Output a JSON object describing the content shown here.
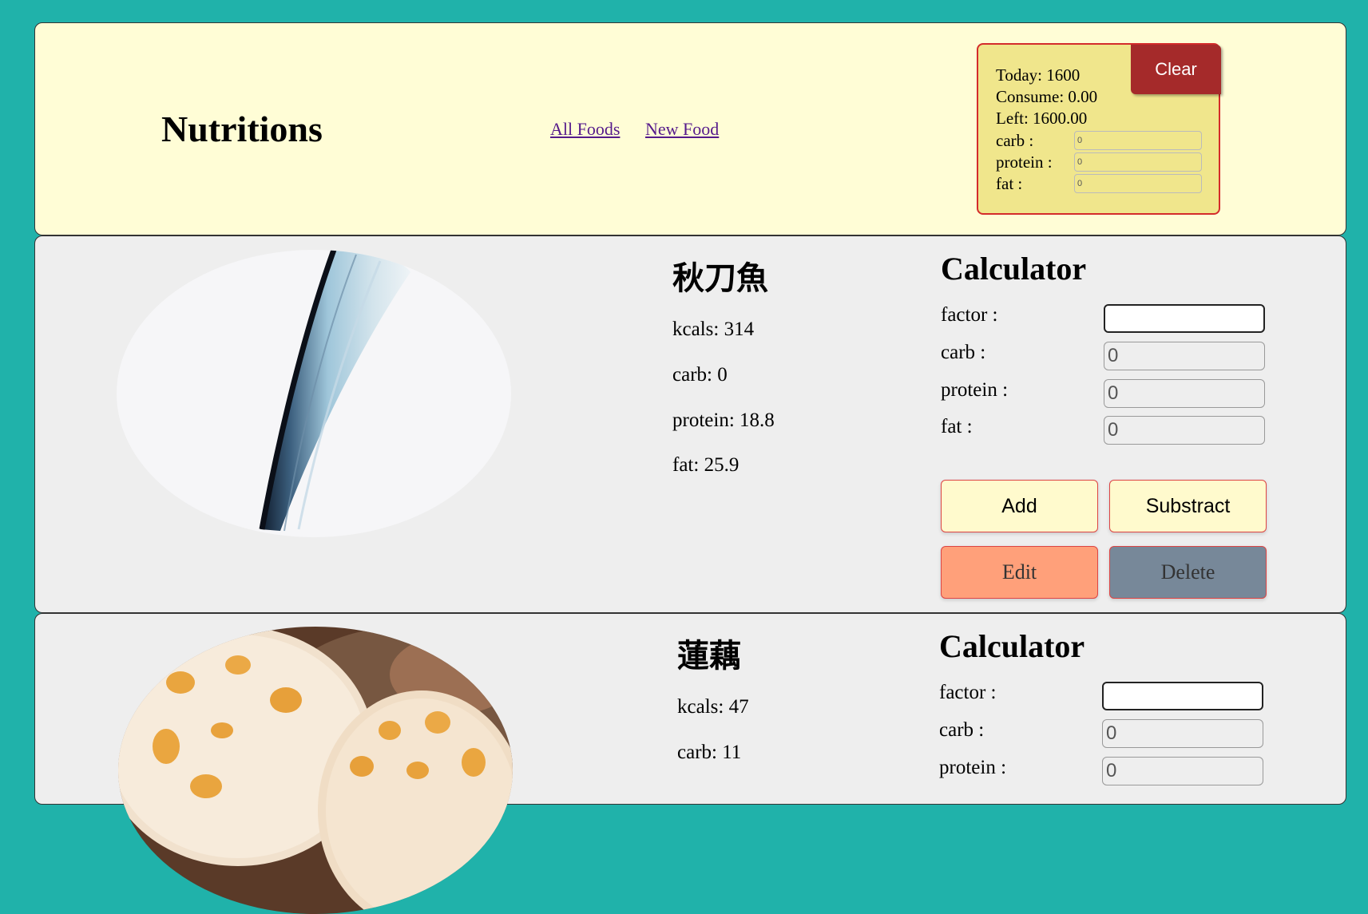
{
  "header": {
    "title": "Nutritions",
    "nav": [
      "All Foods",
      "New Food"
    ]
  },
  "tracker": {
    "today": "Today: 1600",
    "consume": "Consume: 0.00",
    "left": "Left: 1600.00",
    "carb_label": "carb :",
    "protein_label": "protein :",
    "fat_label": "fat :",
    "carb_value": "0",
    "protein_value": "0",
    "fat_value": "0",
    "clear_label": "Clear"
  },
  "calculator_labels": {
    "title": "Calculator",
    "factor": "factor :",
    "carb": "carb :",
    "protein": "protein :",
    "fat": "fat :",
    "add": "Add",
    "subtract": "Substract",
    "edit": "Edit",
    "delete": "Delete"
  },
  "foods": [
    {
      "name": "秋刀魚",
      "kcals": "kcals: 314",
      "carb": "carb: 0",
      "protein": "protein: 18.8",
      "fat": "fat: 25.9",
      "calc": {
        "factor": "",
        "carb": "0",
        "protein": "0",
        "fat": "0"
      }
    },
    {
      "name": "蓮藕",
      "kcals": "kcals: 47",
      "carb": "carb: 11",
      "calc": {
        "factor": "",
        "carb": "0",
        "protein": "0"
      }
    }
  ],
  "colors": {
    "page_bg": "#20b2aa",
    "header_bg": "#fffdd6",
    "tracker_bg": "#f0e68c",
    "clear_bg": "#a52a2a",
    "card_bg": "#eeeeee",
    "edit_bg": "#ffa07a",
    "delete_bg": "#778899"
  }
}
